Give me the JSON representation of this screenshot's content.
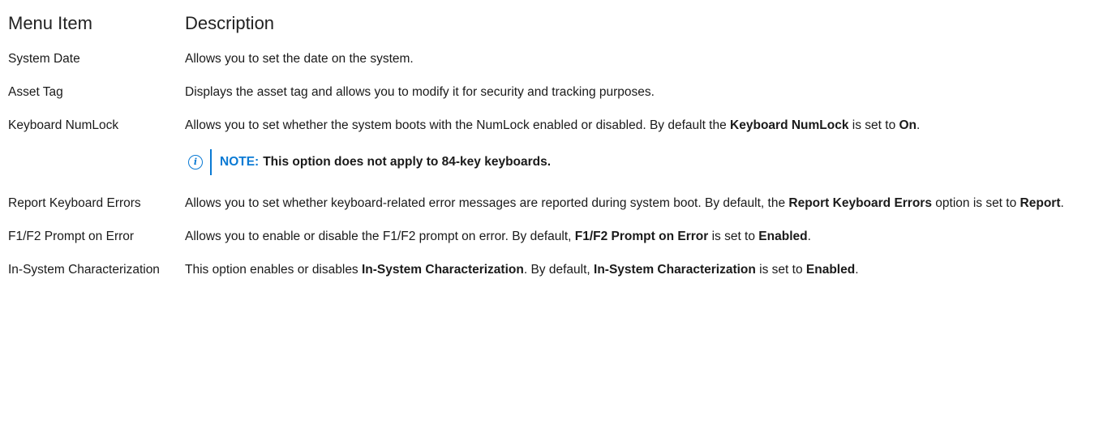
{
  "headers": {
    "item": "Menu Item",
    "description": "Description"
  },
  "rows": {
    "system_date": {
      "item": "System Date",
      "desc": "Allows you to set the date on the system."
    },
    "asset_tag": {
      "item": "Asset Tag",
      "desc": "Displays the asset tag and allows you to modify it for security and tracking purposes."
    },
    "keyboard_numlock": {
      "item": "Keyboard NumLock",
      "desc_1": "Allows you to set whether the system boots with the NumLock enabled or disabled. By default the ",
      "bold_1": "Keyboard NumLock",
      "desc_2": " is set to ",
      "bold_2": "On",
      "desc_3": ".",
      "note_label": "NOTE:",
      "note_text": "This option does not apply to 84-key keyboards."
    },
    "report_keyboard_errors": {
      "item": "Report Keyboard Errors",
      "desc_1": "Allows you to set whether keyboard-related error messages are reported during system boot. By default, the ",
      "bold_1": "Report Keyboard Errors",
      "desc_2": " option is set to ",
      "bold_2": "Report",
      "desc_3": "."
    },
    "f1f2_prompt": {
      "item": "F1/F2 Prompt on Error",
      "desc_1": "Allows you to enable or disable the F1/F2 prompt on error. By default, ",
      "bold_1": "F1/F2 Prompt on Error",
      "desc_2": " is set to ",
      "bold_2": "Enabled",
      "desc_3": "."
    },
    "in_system_char": {
      "item": "In-System Characterization",
      "desc_1": "This option enables or disables ",
      "bold_1": "In-System Characterization",
      "desc_2": ". By default, ",
      "bold_2": "In-System Characterization",
      "desc_3": " is set to ",
      "bold_3": "Enabled",
      "desc_4": "."
    }
  },
  "colors": {
    "note_accent": "#0a7ad4",
    "text": "#1a1a1a"
  },
  "icons": {
    "note": "info-icon"
  }
}
